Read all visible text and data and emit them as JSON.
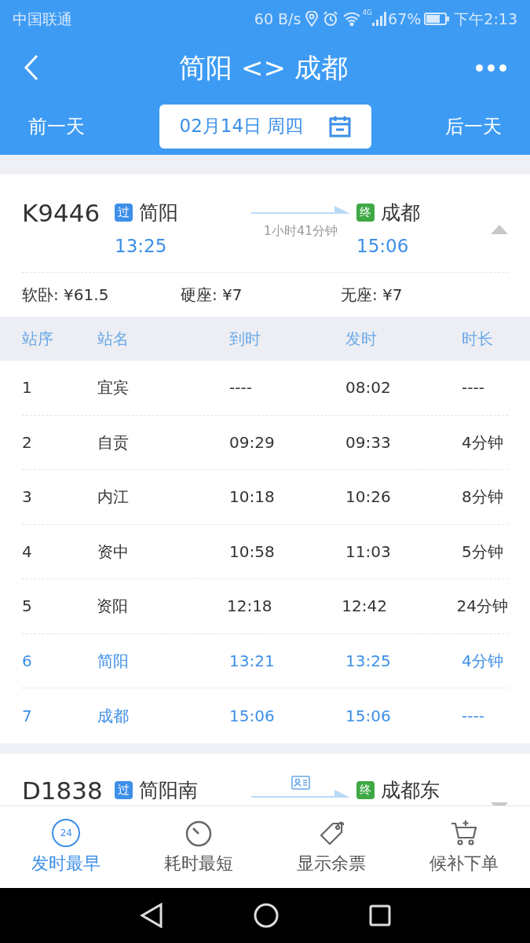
{
  "status_bar": {
    "carrier": "中国联通",
    "speed": "60 B/s",
    "network": "4G",
    "battery": "67%",
    "time": "下午2:13"
  },
  "header": {
    "title": "简阳 <> 成都"
  },
  "date_bar": {
    "prev": "前一天",
    "date": "02月14日 周四",
    "next": "后一天"
  },
  "trains": [
    {
      "number": "K9446",
      "expanded": true,
      "from": {
        "badge": {
          "label": "过",
          "color": "#3d8fe8"
        },
        "station": "简阳",
        "time": "13:25"
      },
      "duration": "1小时41分钟",
      "to": {
        "badge": {
          "label": "终",
          "color": "#3fa845"
        },
        "station": "成都",
        "time": "15:06"
      },
      "prices": [
        {
          "label": "软卧: ¥61.5"
        },
        {
          "label": "硬座: ¥7"
        },
        {
          "label": "无座: ¥7"
        }
      ],
      "stops": {
        "columns": [
          "站序",
          "站名",
          "到时",
          "发时",
          "时长"
        ],
        "rows": [
          {
            "cells": [
              "1",
              "宜宾",
              "----",
              "08:02",
              "----"
            ],
            "highlight": false
          },
          {
            "cells": [
              "2",
              "自贡",
              "09:29",
              "09:33",
              "4分钟"
            ],
            "highlight": false
          },
          {
            "cells": [
              "3",
              "内江",
              "10:18",
              "10:26",
              "8分钟"
            ],
            "highlight": false
          },
          {
            "cells": [
              "4",
              "资中",
              "10:58",
              "11:03",
              "5分钟"
            ],
            "highlight": false
          },
          {
            "cells": [
              "5",
              "资阳",
              "12:18",
              "12:42",
              "24分钟"
            ],
            "highlight": false
          },
          {
            "cells": [
              "6",
              "简阳",
              "13:21",
              "13:25",
              "4分钟"
            ],
            "highlight": true
          },
          {
            "cells": [
              "7",
              "成都",
              "15:06",
              "15:06",
              "----"
            ],
            "highlight": true
          }
        ]
      }
    },
    {
      "number": "D1838",
      "expanded": false,
      "from": {
        "badge": {
          "label": "过",
          "color": "#3d8fe8"
        },
        "station": "简阳南"
      },
      "to": {
        "badge": {
          "label": "终",
          "color": "#3fa845"
        },
        "station": "成都东"
      }
    }
  ],
  "bottom_tabs": [
    {
      "kind": "clock24",
      "label": "发时最早",
      "icon_text": "24",
      "selected": true
    },
    {
      "kind": "timer",
      "label": "耗时最短",
      "selected": false
    },
    {
      "kind": "tag",
      "label": "显示余票",
      "selected": false
    },
    {
      "kind": "cart",
      "label": "候补下单",
      "selected": false
    }
  ]
}
